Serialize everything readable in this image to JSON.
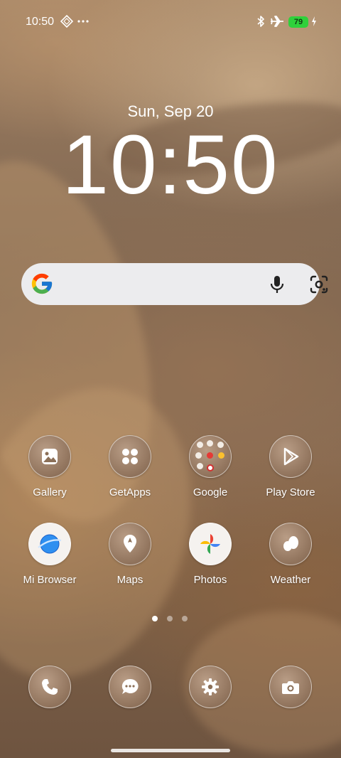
{
  "status_bar": {
    "time": "10:50",
    "battery": "79",
    "icons": [
      "vpn-diamond-icon",
      "more-dots-icon",
      "bluetooth-icon",
      "airplane-icon",
      "battery-icon",
      "charging-bolt-icon"
    ]
  },
  "lock": {
    "date": "Sun, Sep 20",
    "clock": "10:50"
  },
  "search": {
    "icons": [
      "google-g-icon",
      "microphone-icon",
      "google-lens-icon"
    ]
  },
  "apps": [
    {
      "label": "Gallery",
      "icon": "gallery-icon"
    },
    {
      "label": "GetApps",
      "icon": "getapps-icon"
    },
    {
      "label": "Google",
      "icon": "google-folder-icon"
    },
    {
      "label": "Play Store",
      "icon": "play-store-icon"
    },
    {
      "label": "Mi Browser",
      "icon": "mi-browser-icon"
    },
    {
      "label": "Maps",
      "icon": "maps-icon"
    },
    {
      "label": "Photos",
      "icon": "photos-icon"
    },
    {
      "label": "Weather",
      "icon": "weather-icon"
    }
  ],
  "pages": {
    "count": 3,
    "current": 1
  },
  "dock": [
    "phone-icon",
    "messages-icon",
    "settings-icon",
    "camera-icon"
  ],
  "colors": {
    "battery": "#2fd13b",
    "search_bg": "#ececee",
    "text": "#ffffff"
  }
}
